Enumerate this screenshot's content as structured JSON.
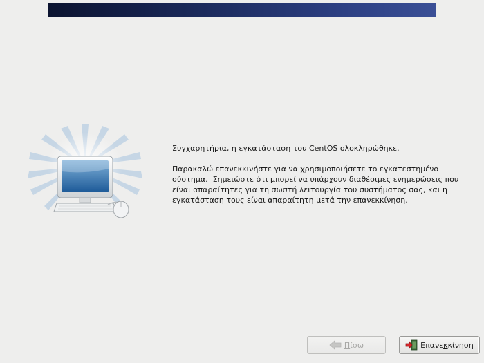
{
  "message": {
    "line1": "Συγχαρητήρια, η εγκατάσταση του CentOS ολοκληρώθηκε.",
    "para2_line1": "Παρακαλώ επανεκκινήστε για να χρησιμοποιήσετε το εγκατεστημένο",
    "para2_line2": "σύστημα.  Σημειώστε ότι μπορεί να υπάρχουν διαθέσιμες ενημερώσεις που",
    "para2_line3": "είναι απαραίτητες για τη σωστή λειτουργία του συστήματος σας, και η",
    "para2_line4": "εγκατάσταση τους είναι απαραίτητη μετά την επανεκκίνηση."
  },
  "buttons": {
    "back": {
      "label_pre": "",
      "label_mnemonic": "Π",
      "label_post": "ίσω",
      "enabled": false,
      "icon": "left-arrow-icon"
    },
    "reboot": {
      "label_pre": "Επανε",
      "label_mnemonic": "κ",
      "label_post": "κίνηση",
      "enabled": true,
      "icon": "exit-door-icon"
    }
  },
  "colors": {
    "background": "#eeeeed",
    "banner_dark": "#0b1330",
    "banner_light": "#3a4f96",
    "exit_arrow": "#d8262a"
  },
  "illustration": {
    "icon": "computer-icon"
  }
}
